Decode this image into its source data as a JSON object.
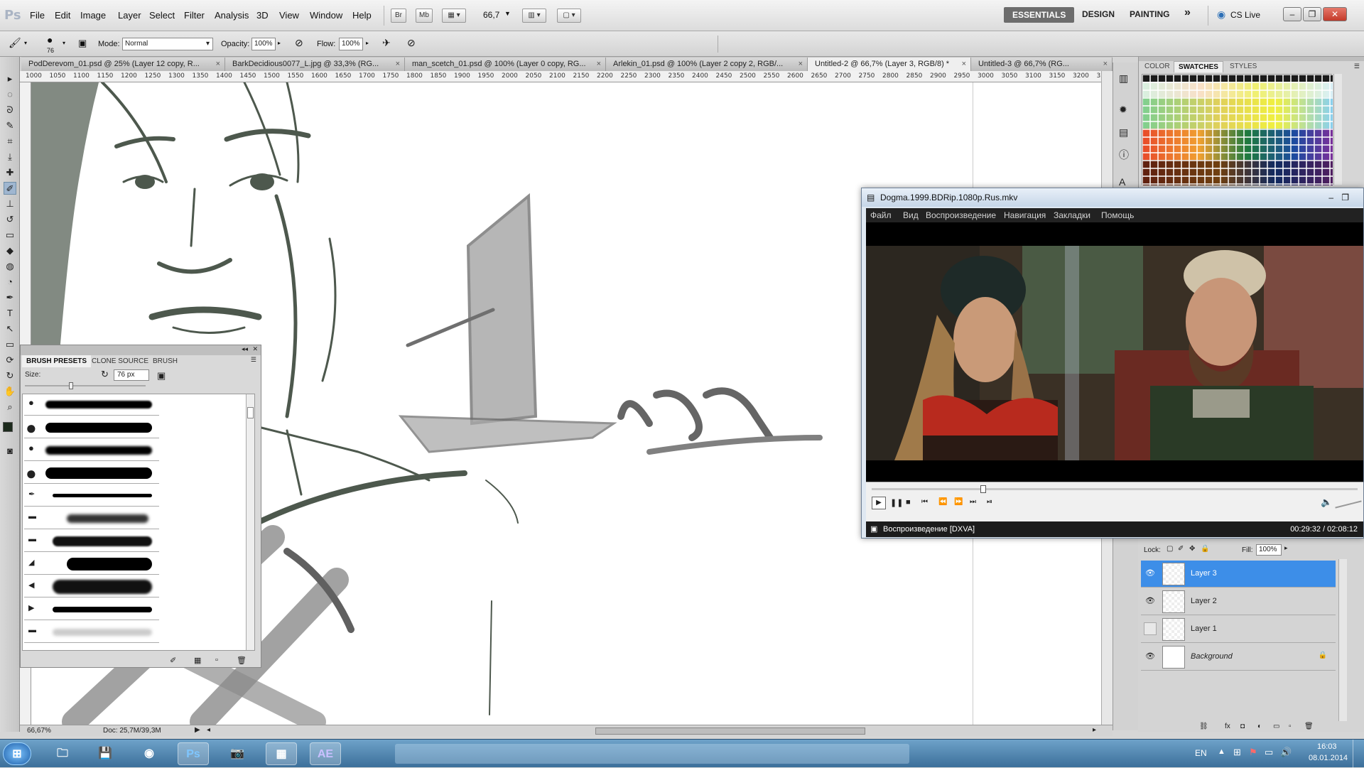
{
  "app": {
    "logo": "Ps"
  },
  "menu": [
    "File",
    "Edit",
    "Image",
    "Layer",
    "Select",
    "Filter",
    "Analysis",
    "3D",
    "View",
    "Window",
    "Help"
  ],
  "appbar": {
    "zoom": "66,7",
    "mini_br": "Br",
    "mini_mb": "Mb"
  },
  "workspaces": {
    "essentials": "ESSENTIALS",
    "design": "DESIGN",
    "painting": "PAINTING",
    "more": "»",
    "cslive": "CS Live"
  },
  "options": {
    "brush_size": "76",
    "mode_label": "Mode:",
    "mode_value": "Normal",
    "opacity_label": "Opacity:",
    "opacity_value": "100%",
    "flow_label": "Flow:",
    "flow_value": "100%"
  },
  "tabs": [
    "PodDerevom_01.psd @ 25% (Layer 12 copy, R...",
    "BarkDecidious0077_L.jpg @ 33,3% (RG...",
    "man_scetch_01.psd @ 100% (Layer 0 copy, RG...",
    "Arlekin_01.psd @ 100% (Layer 2 copy 2, RGB/...",
    "Untitled-2 @ 66,7% (Layer 3, RGB/8) *",
    "Untitled-3 @ 66,7% (RG..."
  ],
  "ruler": [
    "1000",
    "1050",
    "1100",
    "1150",
    "1200",
    "1250",
    "1300",
    "1350",
    "1400",
    "1450",
    "1500",
    "1550",
    "1600",
    "1650",
    "1700",
    "1750",
    "1800",
    "1850",
    "1900",
    "1950",
    "2000",
    "2050",
    "2100",
    "2150",
    "2200",
    "2250",
    "2300",
    "2350",
    "2400",
    "2450",
    "2500",
    "2550",
    "2600",
    "2650",
    "2700",
    "2750",
    "2800",
    "2850",
    "2900",
    "2950",
    "3000",
    "3050",
    "3100",
    "3150",
    "3200",
    "32"
  ],
  "right_panel_tabs": {
    "color": "COLOR",
    "swatches": "SWATCHES",
    "styles": "STYLES"
  },
  "brush_panel": {
    "tabs": [
      "BRUSH PRESETS",
      "CLONE SOURCE",
      "BRUSH"
    ],
    "size_label": "Size:",
    "size_value": "76 px"
  },
  "status": {
    "zoom": "66,67%",
    "doc": "Doc: 25,7M/39,3M"
  },
  "video": {
    "title": "Dogma.1999.BDRip.1080p.Rus.mkv",
    "menu": [
      "Файл",
      "Вид",
      "Воспроизведение",
      "Навигация",
      "Закладки",
      "Помощь"
    ],
    "status_left": "Воспроизведение [DXVA]",
    "time": "00:29:32 / 02:08:12",
    "progress": 0.23
  },
  "layers_panel": {
    "lock_label": "Lock:",
    "fill_label": "Fill:",
    "fill_value": "100%",
    "items": [
      {
        "name": "Layer 3",
        "visible": true,
        "selected": true
      },
      {
        "name": "Layer 2",
        "visible": true,
        "selected": false
      },
      {
        "name": "Layer 1",
        "visible": false,
        "selected": false
      },
      {
        "name": "Background",
        "visible": true,
        "selected": false
      }
    ]
  },
  "taskbar": {
    "lang": "EN",
    "time": "16:03",
    "date": "08.01.2014",
    "apps": [
      "start",
      "explorer",
      "save",
      "chrome",
      "Ps",
      "camera",
      "calendar",
      "AE"
    ]
  },
  "colors": {
    "selection_blue": "#3d8ee8",
    "taskbar": "#4a7fab"
  }
}
